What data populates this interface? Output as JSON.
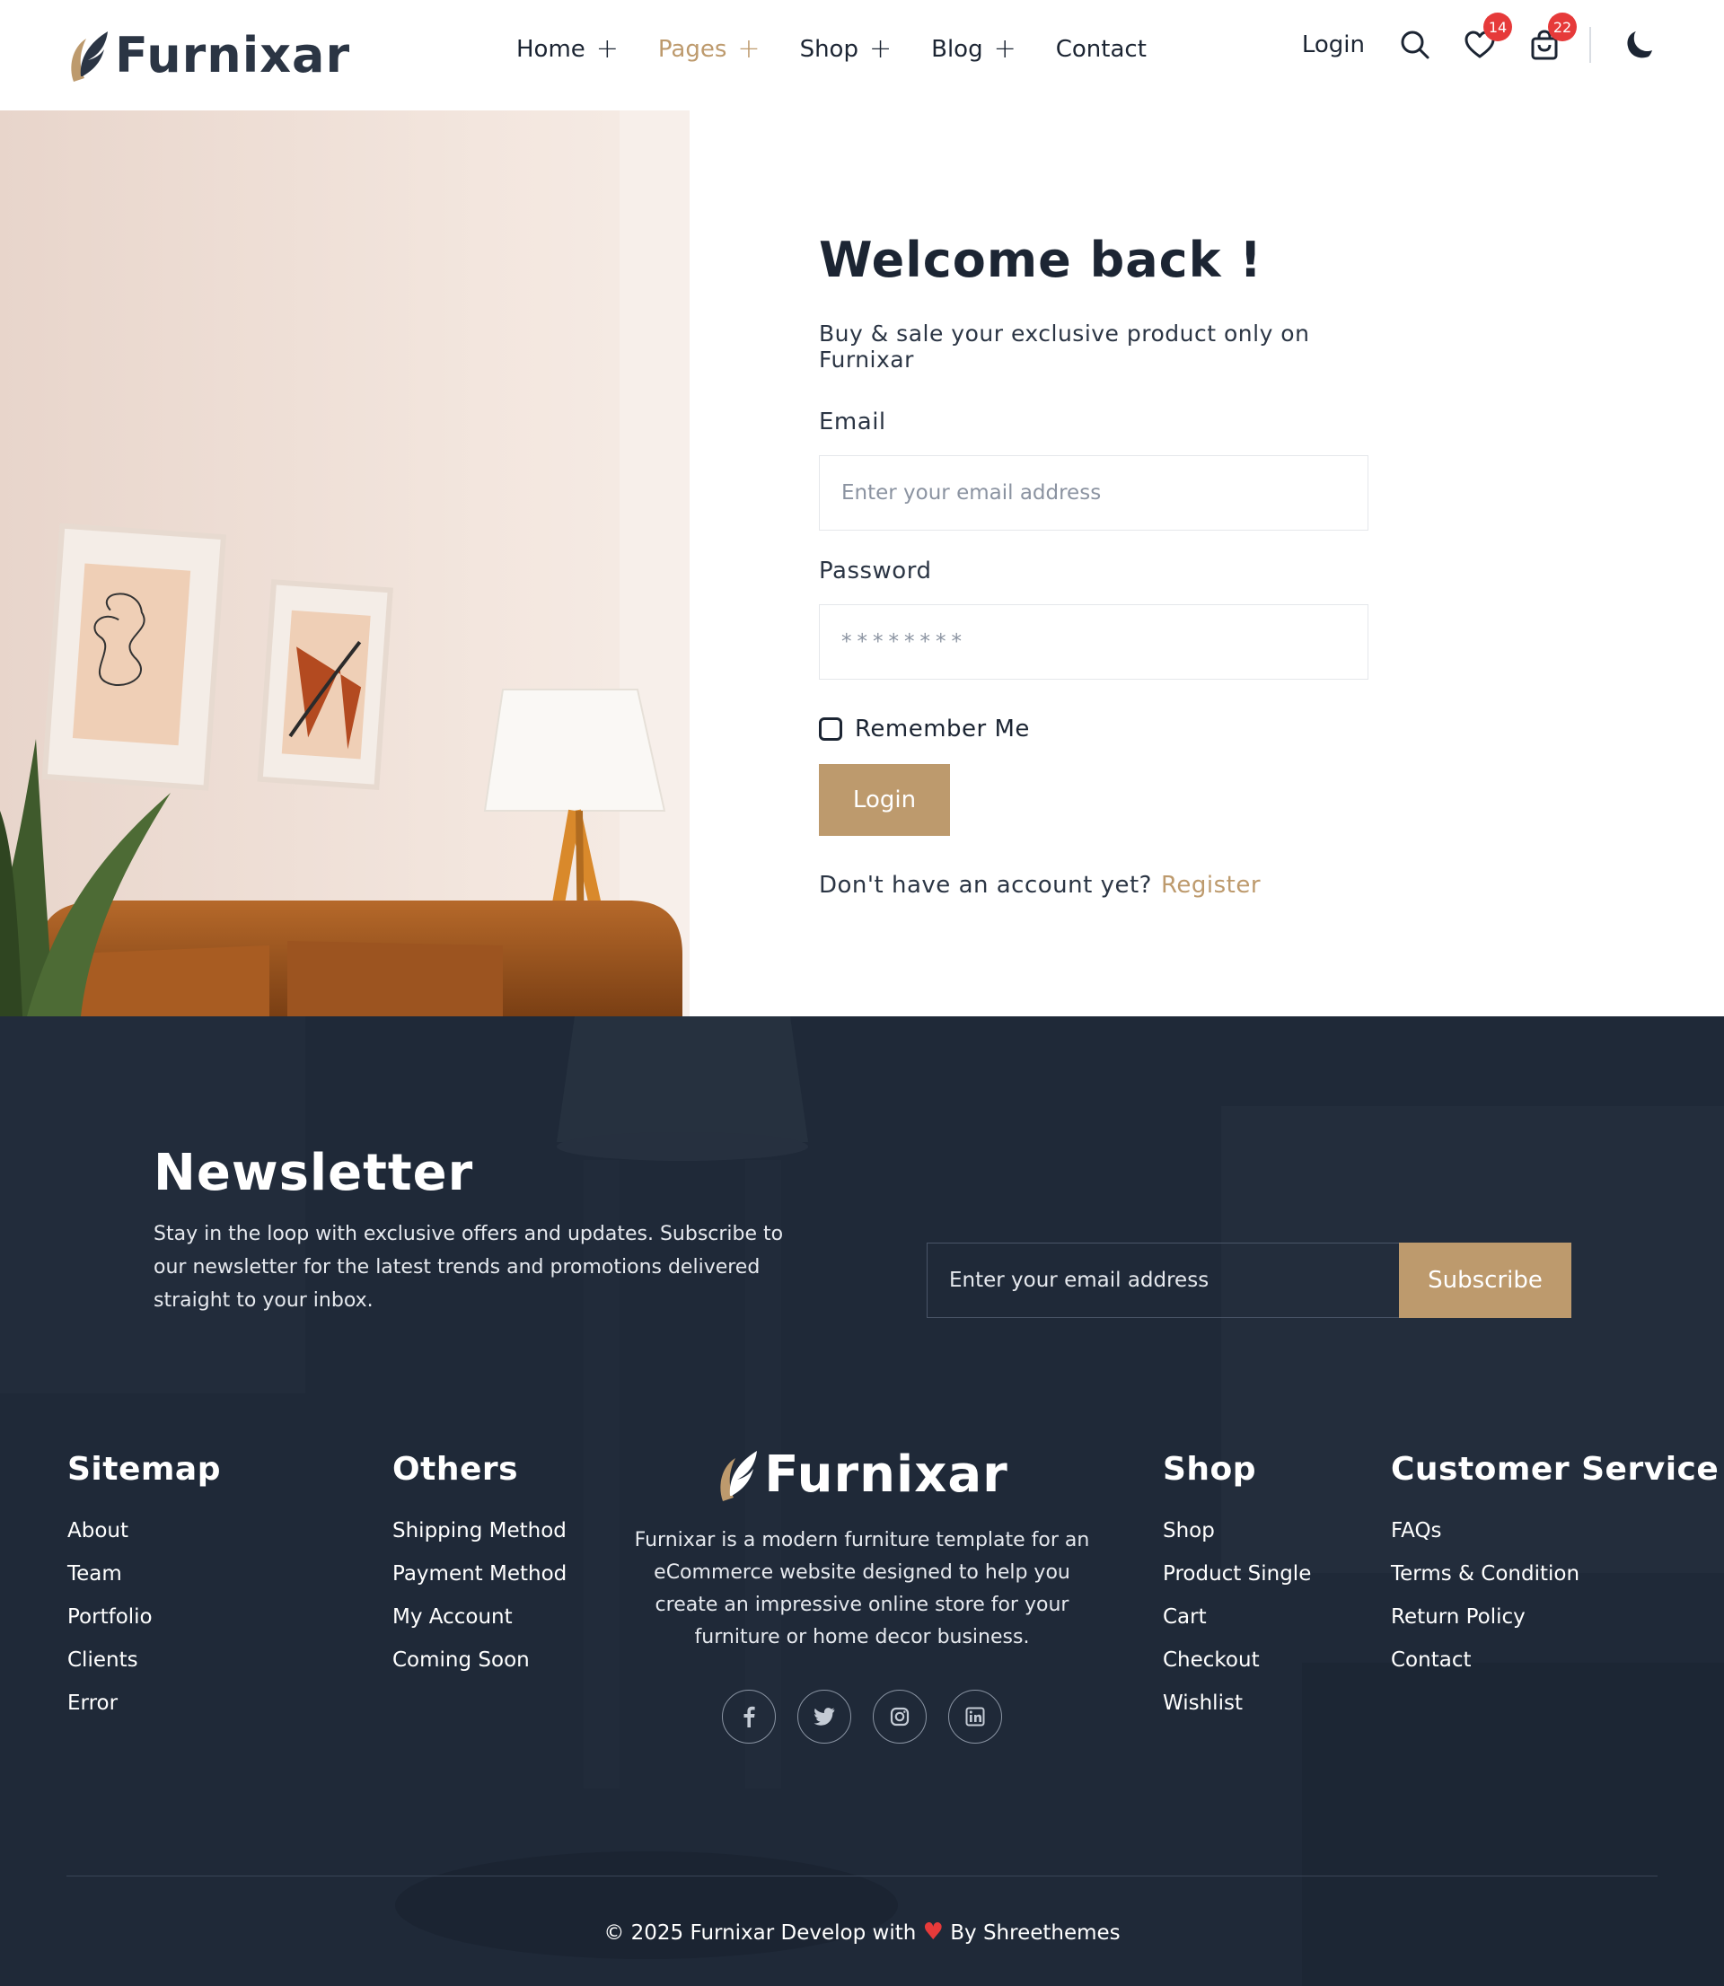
{
  "header": {
    "brand": "Furnixar",
    "nav": [
      {
        "label": "Home",
        "has_submenu": true,
        "active": false
      },
      {
        "label": "Pages",
        "has_submenu": true,
        "active": true
      },
      {
        "label": "Shop",
        "has_submenu": true,
        "active": false
      },
      {
        "label": "Blog",
        "has_submenu": true,
        "active": false
      },
      {
        "label": "Contact",
        "has_submenu": false,
        "active": false
      }
    ],
    "login_label": "Login",
    "wishlist_count": "14",
    "cart_count": "22",
    "icons": [
      "search-icon",
      "heart-icon",
      "shopping-bag-icon",
      "moon-icon"
    ]
  },
  "login": {
    "title": "Welcome back !",
    "subtitle": "Buy & sale your exclusive product only on Furnixar",
    "email_label": "Email",
    "email_placeholder": "Enter your email address",
    "password_label": "Password",
    "password_value": "********",
    "remember_label": "Remember Me",
    "remember_checked": false,
    "submit_label": "Login",
    "register_prompt": "Don't have an account yet?",
    "register_link": "Register"
  },
  "newsletter": {
    "title": "Newsletter",
    "description": "Stay in the loop with exclusive offers and updates. Subscribe to our newsletter for the latest trends and promotions delivered straight to your inbox.",
    "input_placeholder": "Enter your email address",
    "button_label": "Subscribe"
  },
  "footer": {
    "sitemap": {
      "title": "Sitemap",
      "links": [
        "About",
        "Team",
        "Portfolio",
        "Clients",
        "Error"
      ]
    },
    "others": {
      "title": "Others",
      "links": [
        "Shipping Method",
        "Payment Method",
        "My Account",
        "Coming Soon"
      ]
    },
    "brand": {
      "name": "Furnixar",
      "description": "Furnixar is a modern furniture template for an eCommerce website designed to help you create an impressive online store for your furniture or home decor business.",
      "socials": [
        "facebook-icon",
        "twitter-icon",
        "instagram-icon",
        "linkedin-icon"
      ]
    },
    "shop": {
      "title": "Shop",
      "links": [
        "Shop",
        "Product Single",
        "Cart",
        "Checkout",
        "Wishlist"
      ]
    },
    "customer_service": {
      "title": "Customer Service",
      "links": [
        "FAQs",
        "Terms & Condition",
        "Return Policy",
        "Contact"
      ]
    },
    "copyright_prefix": "© 2025 Furnixar Develop with",
    "copyright_suffix": "By Shreethemes"
  },
  "colors": {
    "accent": "#bd9a6d",
    "dark": "#1c2533",
    "footer_bg": "#1f2938",
    "badge": "#e63a3a"
  }
}
